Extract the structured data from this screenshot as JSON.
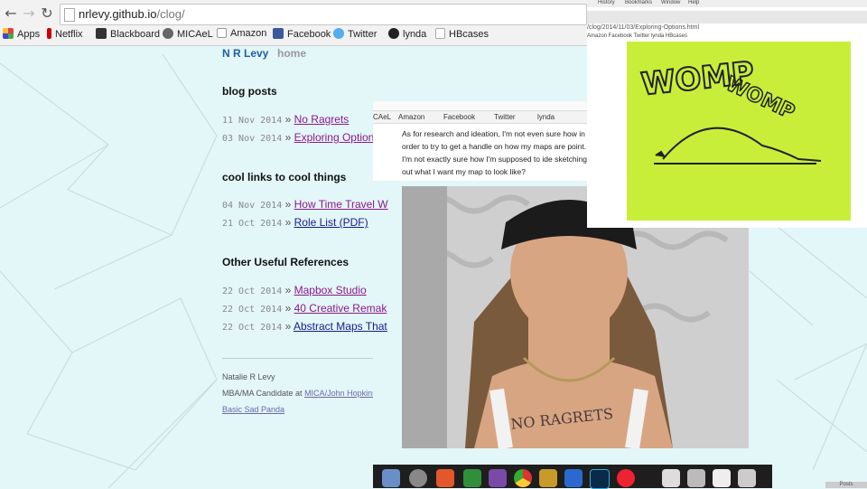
{
  "browser": {
    "url_host": "nrlevy.github.io",
    "url_path": "/clog/",
    "bookmarks": [
      {
        "label": "Apps",
        "color": "#d44"
      },
      {
        "label": "Netflix",
        "color": "#c00"
      },
      {
        "label": "Blackboard",
        "color": "#333"
      },
      {
        "label": "MICAeL",
        "color": "#555"
      },
      {
        "label": "Amazon",
        "color": "#222"
      },
      {
        "label": "Facebook",
        "color": "#3b5998"
      },
      {
        "label": "Twitter",
        "color": "#55acee"
      },
      {
        "label": "lynda",
        "color": "#222"
      },
      {
        "label": "HBcases",
        "color": "#eee"
      }
    ]
  },
  "site": {
    "title": "N R Levy",
    "home_link": "home"
  },
  "sections": {
    "blog_posts": {
      "heading": "blog posts",
      "posts": [
        {
          "date": "11 Nov 2014",
          "sep": "»",
          "title": "No Ragrets"
        },
        {
          "date": "03 Nov 2014",
          "sep": "»",
          "title": "Exploring Options"
        }
      ]
    },
    "cool_links": {
      "heading": "cool links to cool things",
      "posts": [
        {
          "date": "04 Nov 2014",
          "sep": "»",
          "title": "How Time Travel W"
        },
        {
          "date": "21 Oct 2014",
          "sep": "»",
          "title": "Role List (PDF)"
        }
      ]
    },
    "references": {
      "heading": "Other Useful References",
      "posts": [
        {
          "date": "22 Oct 2014",
          "sep": "»",
          "title": "Mapbox Studio"
        },
        {
          "date": "22 Oct 2014",
          "sep": "»",
          "title": "40 Creative Remak"
        },
        {
          "date": "22 Oct 2014",
          "sep": "»",
          "title": "Abstract Maps That"
        }
      ]
    }
  },
  "footer": {
    "name": "Natalie R Levy",
    "role_prefix": "MBA/MA Candidate at",
    "role_link": "MICA/John Hopkins",
    "extra_link": "Basic Sad Panda"
  },
  "overlay_mid": {
    "bookmarks": [
      "CAeL",
      "Amazon",
      "Facebook",
      "Twitter",
      "lynda"
    ],
    "paragraph": "As for research and ideation, I'm not even sure how in order to try to get a handle on how my maps are point. I'm not exactly sure how I'm supposed to ide sketching out what I want my map to look like?",
    "photo_caption": "NO RAGRETS"
  },
  "overlay_top": {
    "url": "/clog/2014/11/03/Exploring-Options.html",
    "menu": [
      "History",
      "Bookmarks",
      "Window",
      "Help"
    ],
    "bookmarks": "Amazon  Facebook  Twitter  lynda  HBcases",
    "sticky_text_1": "WOMP",
    "sticky_text_2": "WOMP"
  },
  "dock_corner_label": "Posts"
}
